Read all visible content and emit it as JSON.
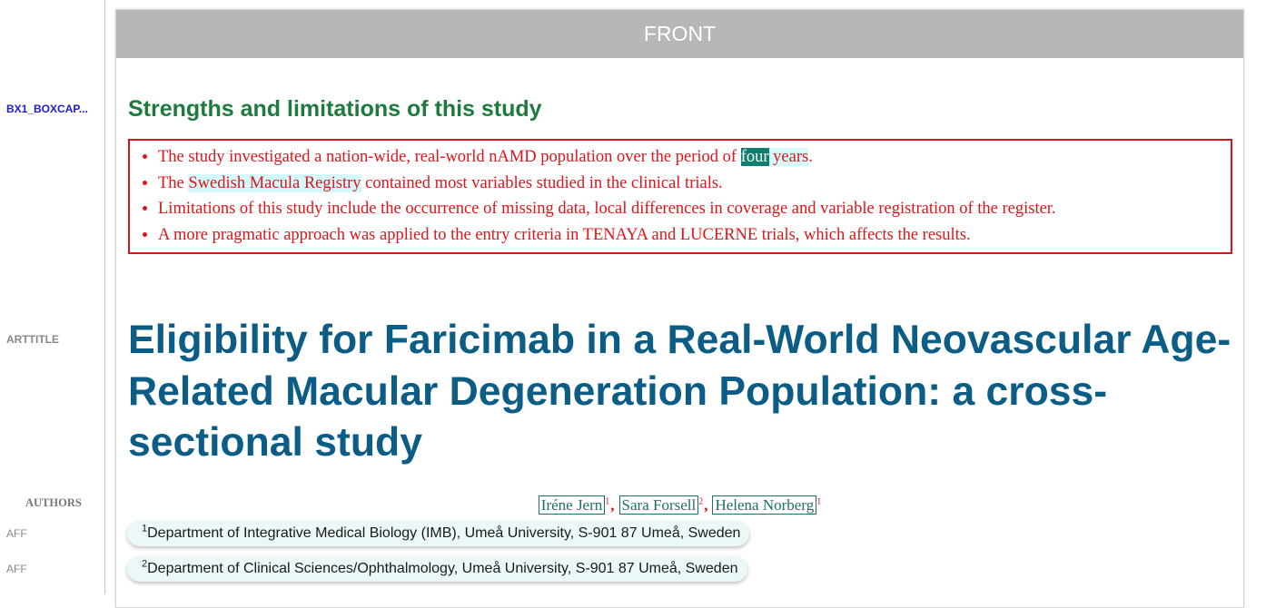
{
  "gutter": {
    "boxcap_tag": "BX1_BOXCAP...",
    "arttitle_tag": "ARTTITLE",
    "authors_tag": "AUTHORS",
    "aff_tag_1": "AFF",
    "aff_tag_2": "AFF"
  },
  "panel": {
    "header": "FRONT"
  },
  "box": {
    "heading": "Strengths and limitations of this study",
    "items": [
      {
        "pre": "The study investigated a nation-wide, real-world nAMD population over the period of ",
        "highlight_strong": "four",
        "highlight_light": " years",
        "post": "."
      },
      {
        "pre": "The ",
        "highlight_light": "Swedish Macula Registry",
        "post": " contained most variables studied in the clinical trials."
      },
      {
        "text": "Limitations of this study include the occurrence of missing data, local differences in coverage and variable registration of the register."
      },
      {
        "text": "A more pragmatic approach was applied to the entry criteria in TENAYA and LUCERNE trials, which affects the results."
      }
    ]
  },
  "article": {
    "title": "Eligibility for Faricimab in a Real-World Neovascular Age-Related Macular Degeneration Population: a cross-sectional study"
  },
  "authors": [
    {
      "name": "Iréne Jern",
      "aff": "1"
    },
    {
      "name": "Sara Forsell",
      "aff": "2"
    },
    {
      "name": "Helena Norberg",
      "aff": "1"
    }
  ],
  "separator": ",",
  "affiliations": [
    {
      "label": "1",
      "text": "Department of Integrative Medical Biology (IMB), Umeå University, S-901 87 Umeå, Sweden"
    },
    {
      "label": "2",
      "text": "Department of Clinical Sciences/Ophthalmology, Umeå University, S-901 87 Umeå, Sweden"
    }
  ],
  "colors": {
    "heading_green": "#1e7b3d",
    "box_red": "#d8161b",
    "title_blue": "#0b5d86",
    "author_teal": "#1a6f6a",
    "highlight_dark": "#0e7e70",
    "highlight_light": "#d3f9fb"
  }
}
